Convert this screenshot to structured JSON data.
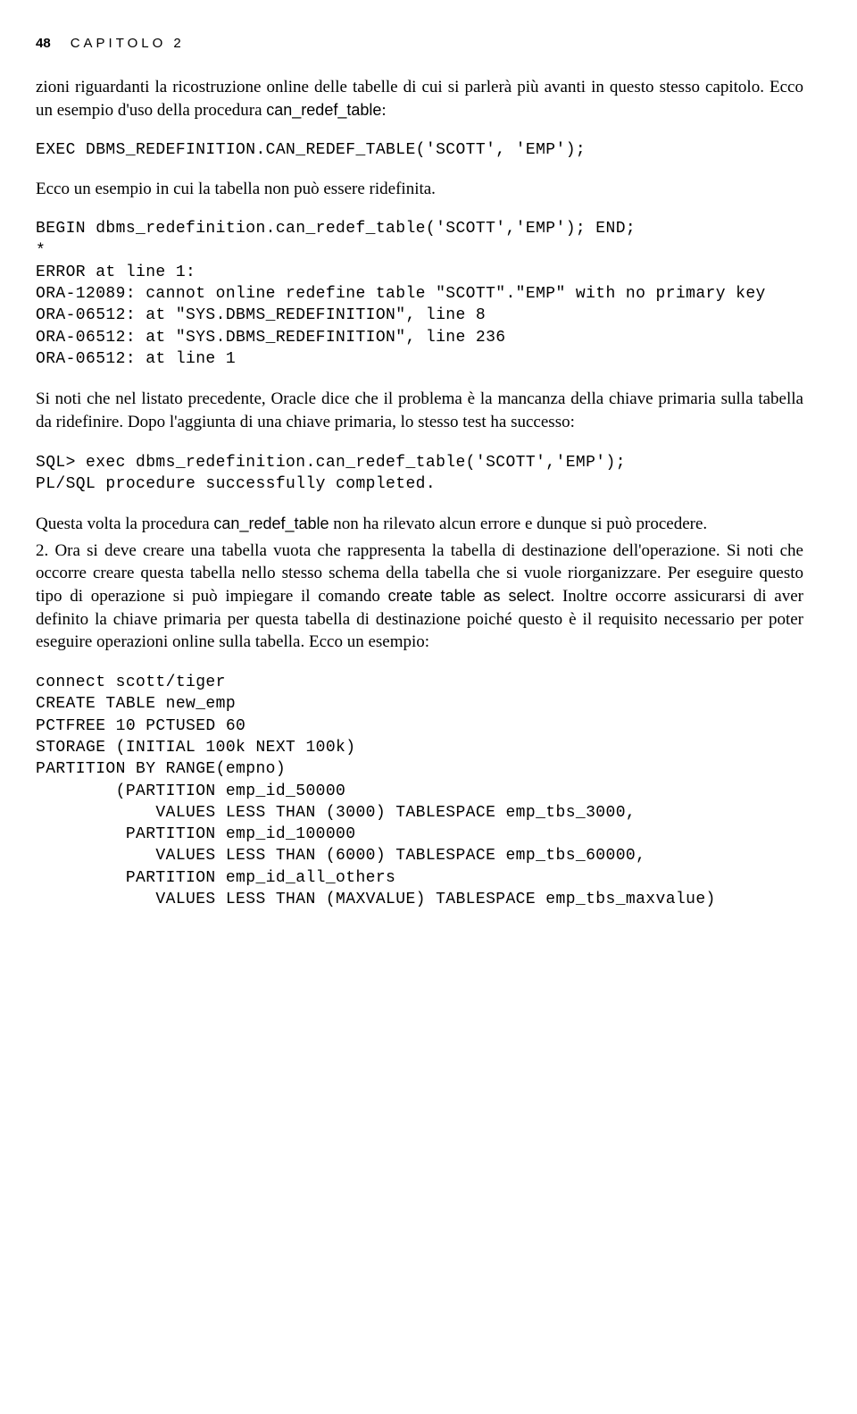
{
  "header": {
    "page_number": "48",
    "chapter_label": "CAPITOLO 2"
  },
  "para1_prefix": "zioni riguardanti la ricostruzione online delle tabelle di cui si parlerà più avanti in questo stesso capitolo. Ecco un esempio d'uso della procedura ",
  "para1_code": "can_redef_table",
  "para1_suffix": ":",
  "code1": "EXEC DBMS_REDEFINITION.CAN_REDEF_TABLE('SCOTT', 'EMP');",
  "para2": "Ecco un esempio in cui la tabella non può essere ridefinita.",
  "code2": "BEGIN dbms_redefinition.can_redef_table('SCOTT','EMP'); END;\n*\nERROR at line 1:\nORA-12089: cannot online redefine table \"SCOTT\".\"EMP\" with no primary key\nORA-06512: at \"SYS.DBMS_REDEFINITION\", line 8\nORA-06512: at \"SYS.DBMS_REDEFINITION\", line 236\nORA-06512: at line 1",
  "para3": "Si noti che nel listato precedente, Oracle dice che il problema è la mancanza della chiave primaria sulla tabella da ridefinire. Dopo l'aggiunta di una chiave primaria, lo stesso test ha successo:",
  "code3": "SQL> exec dbms_redefinition.can_redef_table('SCOTT','EMP');\nPL/SQL procedure successfully completed.",
  "para4_prefix": "Questa volta la procedura ",
  "para4_code": "can_redef_table",
  "para4_suffix": " non ha rilevato alcun errore e dunque si può procedere.",
  "para5_prefix": "2.   Ora si deve creare una tabella vuota che rappresenta la tabella di destinazione dell'operazione. Si noti che occorre creare questa tabella nello stesso schema della tabella che si vuole riorganizzare. Per eseguire questo tipo di operazione si può impiegare il comando ",
  "para5_code": "create table as select",
  "para5_suffix": ". Inoltre occorre assicurarsi di aver definito la chiave primaria per questa tabella di destinazione poiché questo è il requisito necessario per poter eseguire operazioni online sulla tabella. Ecco un esempio:",
  "code4": "connect scott/tiger\nCREATE TABLE new_emp\nPCTFREE 10 PCTUSED 60\nSTORAGE (INITIAL 100k NEXT 100k)\nPARTITION BY RANGE(empno)\n        (PARTITION emp_id_50000\n            VALUES LESS THAN (3000) TABLESPACE emp_tbs_3000,\n         PARTITION emp_id_100000\n            VALUES LESS THAN (6000) TABLESPACE emp_tbs_60000,\n         PARTITION emp_id_all_others\n            VALUES LESS THAN (MAXVALUE) TABLESPACE emp_tbs_maxvalue)"
}
